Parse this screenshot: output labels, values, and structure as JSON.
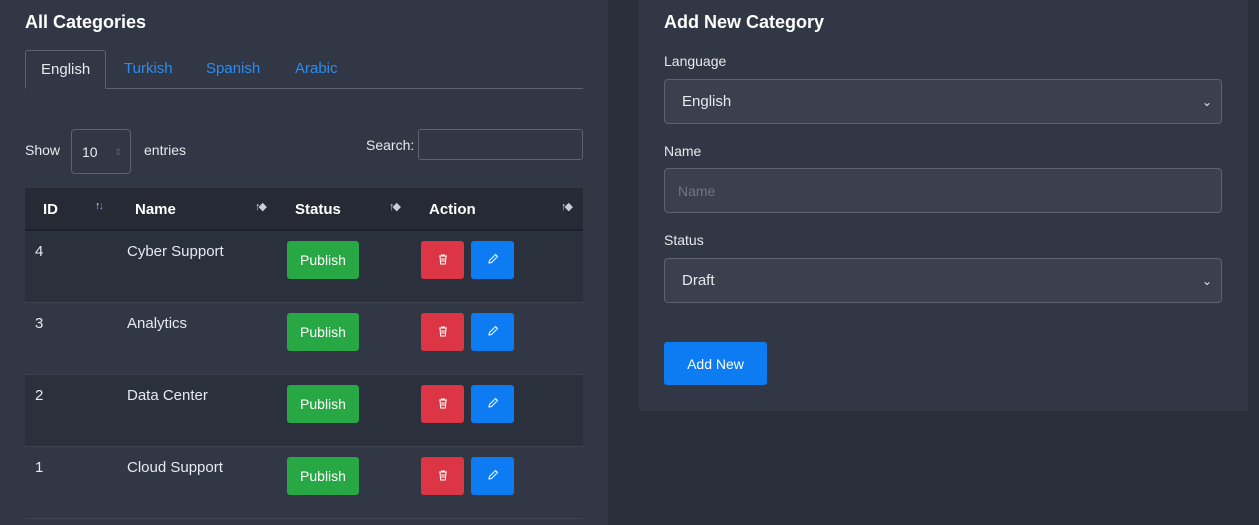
{
  "left_card": {
    "title": "All Categories",
    "tabs": [
      {
        "label": "English",
        "active": true
      },
      {
        "label": "Turkish",
        "active": false
      },
      {
        "label": "Spanish",
        "active": false
      },
      {
        "label": "Arabic",
        "active": false
      }
    ],
    "show_label": "Show",
    "entries_value": "10",
    "entries_label": "entries",
    "search_label": "Search:",
    "search_value": "",
    "columns": [
      "ID",
      "Name",
      "Status",
      "Action"
    ],
    "rows": [
      {
        "id": "4",
        "name": "Cyber Support",
        "status": "Publish"
      },
      {
        "id": "3",
        "name": "Analytics",
        "status": "Publish"
      },
      {
        "id": "2",
        "name": "Data Center",
        "status": "Publish"
      },
      {
        "id": "1",
        "name": "Cloud Support",
        "status": "Publish"
      }
    ]
  },
  "right_card": {
    "title": "Add New Category",
    "language_label": "Language",
    "language_value": "English",
    "name_label": "Name",
    "name_placeholder": "Name",
    "status_label": "Status",
    "status_value": "Draft",
    "add_button": "Add New"
  },
  "colors": {
    "publish": "#28a745",
    "delete": "#dc3545",
    "primary": "#0d7cf2",
    "tab_link": "#2b8df0"
  },
  "icons": {
    "delete": "trash-icon",
    "edit": "pencil-icon",
    "sort": "sort-icon",
    "select": "chevron-down-icon"
  }
}
